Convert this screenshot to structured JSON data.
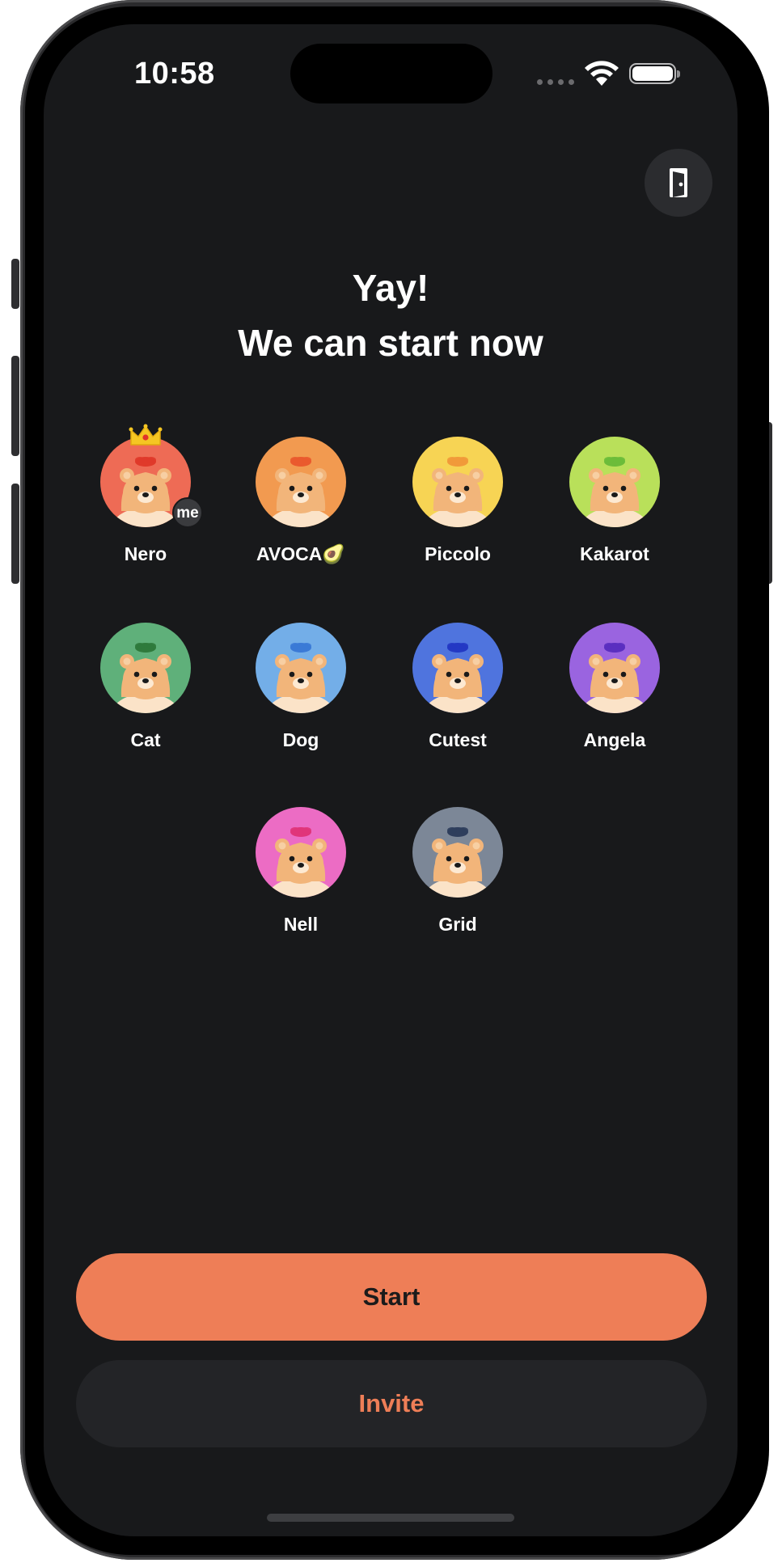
{
  "status_bar": {
    "time": "10:58",
    "icons": [
      "signal-dots-icon",
      "wifi-icon",
      "battery-icon"
    ]
  },
  "header": {
    "leave_icon": "door-exit-icon",
    "title_line1": "Yay!",
    "title_line2": "We can start now"
  },
  "players": [
    {
      "name": "Nero",
      "color": "#ee6b55",
      "tuft": "#e03a2a",
      "host": true,
      "me": true,
      "badge": "me"
    },
    {
      "name": "AVOCA🥑",
      "color": "#f29a50",
      "tuft": "#ea5a2e",
      "host": false,
      "me": false
    },
    {
      "name": "Piccolo",
      "color": "#f7d454",
      "tuft": "#f19a3a",
      "host": false,
      "me": false
    },
    {
      "name": "Kakarot",
      "color": "#b9e05a",
      "tuft": "#6cbc3a",
      "host": false,
      "me": false
    },
    {
      "name": "Cat",
      "color": "#5fb07a",
      "tuft": "#2f7a3c",
      "host": false,
      "me": false
    },
    {
      "name": "Dog",
      "color": "#73aee8",
      "tuft": "#3b7ad6",
      "host": false,
      "me": false
    },
    {
      "name": "Cutest",
      "color": "#4f74de",
      "tuft": "#2339c4",
      "host": false,
      "me": false
    },
    {
      "name": "Angela",
      "color": "#9a64e0",
      "tuft": "#5a2fc0",
      "host": false,
      "me": false
    },
    {
      "name": "Nell",
      "color": "#ec6cc4",
      "tuft": "#e0357a",
      "host": false,
      "me": false
    },
    {
      "name": "Grid",
      "color": "#7c8797",
      "tuft": "#2f3e5c",
      "host": false,
      "me": false
    }
  ],
  "actions": {
    "start_label": "Start",
    "invite_label": "Invite"
  },
  "colors": {
    "background": "#18191b",
    "accent": "#ee7e57",
    "secondary_button": "#232427"
  }
}
